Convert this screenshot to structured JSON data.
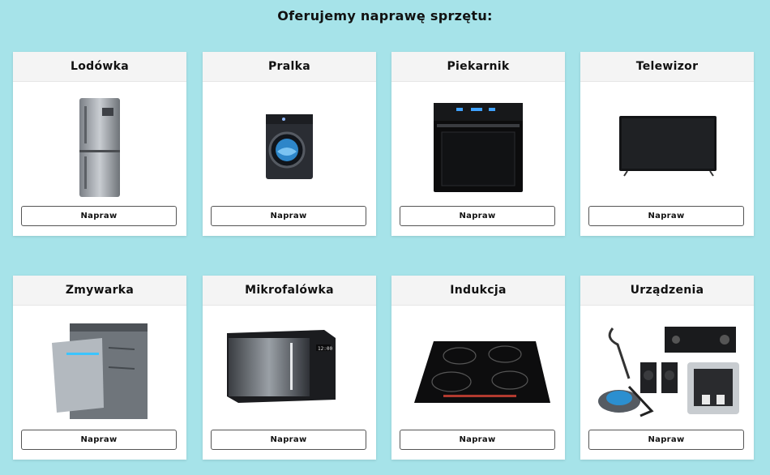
{
  "heading": "Oferujemy naprawę sprzętu:",
  "cards": [
    {
      "title": "Lodówka",
      "icon": "fridge-icon",
      "button": "Napraw"
    },
    {
      "title": "Pralka",
      "icon": "washing-machine-icon",
      "button": "Napraw"
    },
    {
      "title": "Piekarnik",
      "icon": "oven-icon",
      "button": "Napraw"
    },
    {
      "title": "Telewizor",
      "icon": "tv-icon",
      "button": "Napraw"
    },
    {
      "title": "Zmywarka",
      "icon": "dishwasher-icon",
      "button": "Napraw"
    },
    {
      "title": "Mikrofalówka",
      "icon": "microwave-icon",
      "button": "Napraw"
    },
    {
      "title": "Indukcja",
      "icon": "induction-hob-icon",
      "button": "Napraw"
    },
    {
      "title": "Urządzenia",
      "icon": "appliances-icon",
      "button": "Napraw"
    }
  ],
  "colors": {
    "background": "#a6e3e9",
    "card": "#ffffff",
    "card_header": "#f4f4f4"
  }
}
